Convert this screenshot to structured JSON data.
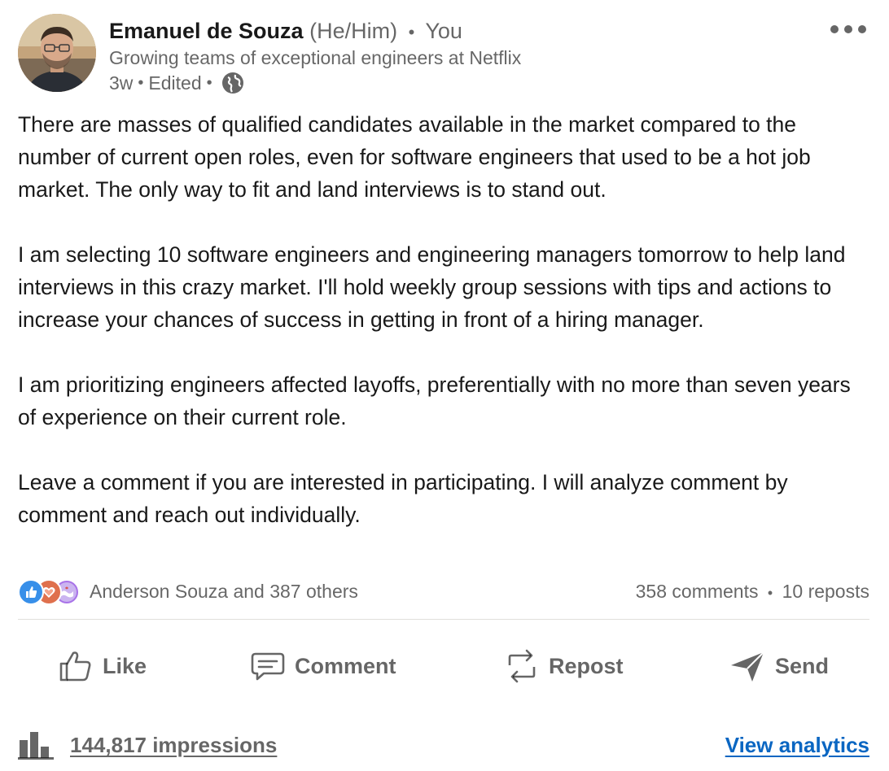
{
  "author": {
    "name": "Emanuel de Souza",
    "pronouns": "(He/Him)",
    "separator": "•",
    "relation": "You",
    "headline": "Growing teams of exceptional engineers at Netflix",
    "time": "3w",
    "edited": "Edited",
    "visibility_icon": "globe-icon"
  },
  "menu_icon": "more-horizontal-icon",
  "post": {
    "paragraphs": [
      "There are masses of qualified candidates available in the market compared to the number of current open roles, even for software engineers that used to be a hot job market. The only way to fit and land interviews is to stand out.",
      "I am selecting 10 software engineers and engineering managers tomorrow to help land interviews in this crazy market. I'll hold weekly group sessions with tips and actions to increase your chances of success in getting in front of a hiring manager.",
      "I am prioritizing engineers affected layoffs, preferentially with no more than seven years of experience on their current role.",
      "Leave a comment if you are interested in participating. I will analyze comment by comment and reach out individually."
    ]
  },
  "social": {
    "reaction_icons": [
      "like-reaction-icon",
      "love-reaction-icon",
      "support-reaction-icon"
    ],
    "reactions_text": "Anderson Souza and 387 others",
    "comments": "358 comments",
    "separator": "•",
    "reposts": "10 reposts"
  },
  "actions": {
    "like": "Like",
    "comment": "Comment",
    "repost": "Repost",
    "send": "Send"
  },
  "analytics": {
    "impressions": "144,817 impressions",
    "view": "View analytics"
  },
  "colors": {
    "link": "#0a66c2",
    "like_reaction": "#378fe9",
    "love_reaction": "#df704d",
    "support_reaction": "#a872e8"
  }
}
